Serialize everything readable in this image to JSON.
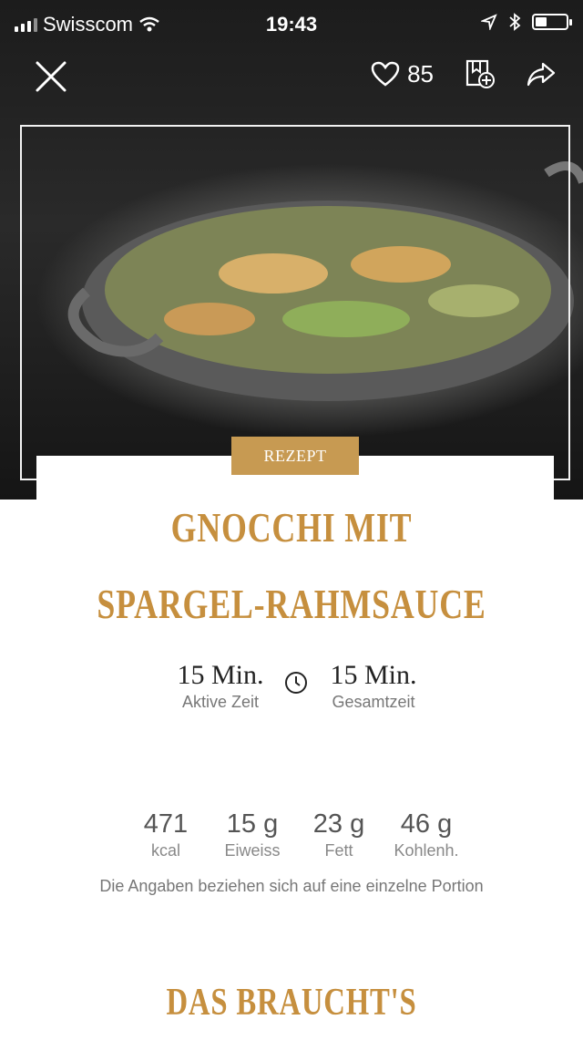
{
  "status_bar": {
    "carrier": "Swisscom",
    "time": "19:43"
  },
  "actions": {
    "like_count": "85"
  },
  "badge": {
    "label": "REZEPT"
  },
  "recipe": {
    "title_line1": "GNOCCHI MIT",
    "title_line2": "SPARGEL-RAHMSAUCE",
    "active_time": "15 Min.",
    "active_label": "Aktive Zeit",
    "total_time": "15 Min.",
    "total_label": "Gesamtzeit"
  },
  "nutrition": [
    {
      "value": "471",
      "label": "kcal"
    },
    {
      "value": "15 g",
      "label": "Eiweiss"
    },
    {
      "value": "23 g",
      "label": "Fett"
    },
    {
      "value": "46 g",
      "label": "Kohlenh."
    }
  ],
  "nutrition_note": "Die Angaben beziehen sich auf eine einzelne Portion",
  "section_title": "DAS BRAUCHT'S"
}
